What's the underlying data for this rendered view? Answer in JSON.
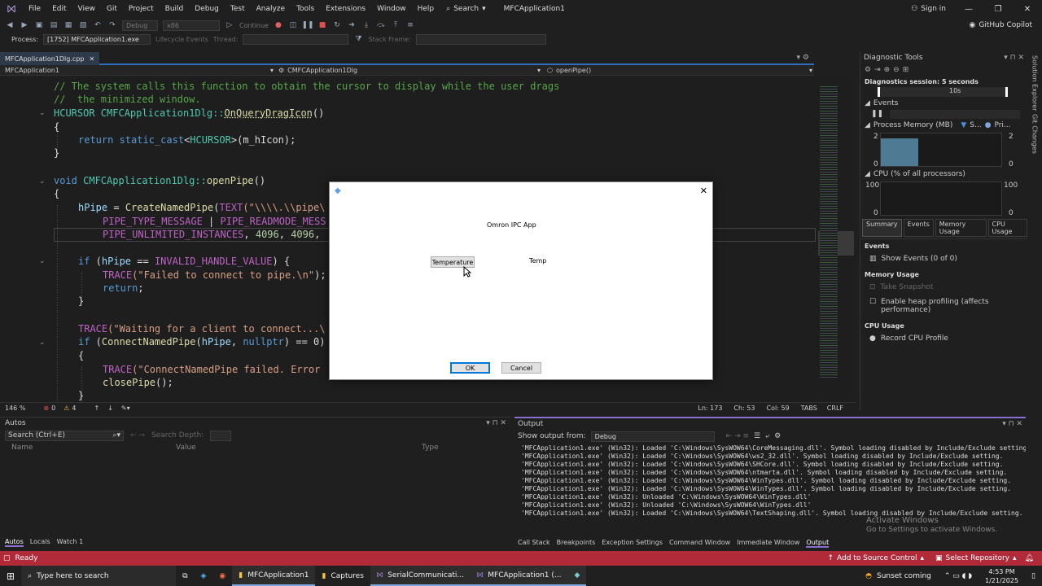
{
  "menubar": {
    "items": [
      "File",
      "Edit",
      "View",
      "Git",
      "Project",
      "Build",
      "Debug",
      "Test",
      "Analyze",
      "Tools",
      "Extensions",
      "Window",
      "Help"
    ],
    "search_label": "Search",
    "solution_name": "MFCApplication1",
    "signin_label": "Sign in",
    "minimize_glyph": "—",
    "maximize_glyph": "❐",
    "close_glyph": "✕"
  },
  "toolbar": {
    "config": "Debug",
    "platform": "x86",
    "continue_label": "Continue",
    "copilot_label": "GitHub Copilot"
  },
  "toolbar2": {
    "process_label": "Process:",
    "process_value": "[1752] MFCApplication1.exe",
    "lifecycle_label": "Lifecycle Events",
    "thread_label": "Thread:",
    "stackframe_label": "Stack Frame:"
  },
  "doc_tab": {
    "label": "MFCApplication1Dlg.cpp",
    "close": "✕"
  },
  "navbar": {
    "project": "MFCApplication1",
    "class": "CMFCApplication1Dlg",
    "member": "openPipe()"
  },
  "code": {
    "l1": "// The system calls this function to obtain the cursor to display while the user drags",
    "l2": "//  the minimized window.",
    "l3_type": "HCURSOR",
    "l3_class": " CMFCApplication1Dlg::",
    "l3_fn": "OnQueryDragIcon",
    "l3_rest": "()",
    "l4": "{",
    "l5_kw": "return",
    "l5_cast": " static_cast",
    "l5_t": "<",
    "l5_type": "HCURSOR",
    "l5_rest": ">(m_hIcon);",
    "l6": "}",
    "l8_kw": "void",
    "l8_class": " CMFCApplication1Dlg::",
    "l8_fn": "openPipe",
    "l8_rest": "()",
    "l9": "{",
    "l10_var": "hPipe",
    "l10_eq": " = ",
    "l10_fn": "CreateNamedPipe",
    "l10_p": "(",
    "l10_mac": "TEXT",
    "l10_str": "(\"\\\\\\\\.\\\\pipe\\",
    "l11_mac": "PIPE_TYPE_MESSAGE",
    "l11_op": " | ",
    "l11_mac2": "PIPE_READMODE_MESS",
    "l12_mac": "PIPE_UNLIMITED_INSTANCES",
    "l12_rest": ", ",
    "l12_num1": "4096",
    "l12_c": ", ",
    "l12_num2": "4096",
    "l12_end": ",",
    "l14_kw": "if",
    "l14_p": " (",
    "l14_var": "hPipe",
    "l14_op": " == ",
    "l14_mac": "INVALID_HANDLE_VALUE",
    "l14_end": ") {",
    "l15_mac": "TRACE",
    "l15_str": "(\"Failed to connect to pipe.\\n\"",
    "l15_end": ");",
    "l16_kw": "return",
    "l16_end": ";",
    "l17": "}",
    "l19_mac": "TRACE",
    "l19_str": "(\"Waiting for a client to connect...\\",
    "l20_kw": "if",
    "l20_p": " (",
    "l20_fn": "ConnectNamedPipe",
    "l20_a": "(",
    "l20_var": "hPipe",
    "l20_c": ", ",
    "l20_kw2": "nullptr",
    "l20_end": ") == 0)",
    "l21": "{",
    "l22_mac": "TRACE",
    "l22_str": "(\"ConnectNamedPipe failed. Error",
    "l23_fn": "closePipe",
    "l23_end": "();",
    "l24": "}"
  },
  "editor_status": {
    "zoom": "146 %",
    "errors": "0",
    "warnings": "4",
    "ln": "Ln: 173",
    "ch": "Ch: 53",
    "col": "Col: 59",
    "tabs": "TABS",
    "eol": "CRLF"
  },
  "diag": {
    "title": "Diagnostic Tools",
    "session": "Diagnostics session: 5 seconds",
    "time_tick": "10s",
    "events_label": "Events",
    "memory_label": "Process Memory (MB)",
    "memory_legend1": "S...",
    "memory_legend2": "Pri...",
    "mem_y_top": "2",
    "mem_y_bottom": "0",
    "cpu_label": "CPU (% of all processors)",
    "cpu_y_top": "100",
    "cpu_y_bottom": "0",
    "tabs": [
      "Summary",
      "Events",
      "Memory Usage",
      "CPU Usage"
    ],
    "sec_events": "Events",
    "show_events": "Show Events (0 of 0)",
    "sec_memory": "Memory Usage",
    "take_snapshot": "Take Snapshot",
    "heap_profiling": "Enable heap profiling (affects performance)",
    "sec_cpu": "CPU Usage",
    "record_cpu": "Record CPU Profile",
    "memory_fraction": 0.85
  },
  "side_tabs": [
    "Solution Explorer",
    "Git Changes"
  ],
  "autos": {
    "title": "Autos",
    "search_placeholder": "Search (Ctrl+E)",
    "search_depth": "Search Depth:",
    "col_name": "Name",
    "col_value": "Value",
    "col_type": "Type",
    "tabs": [
      "Autos",
      "Locals",
      "Watch 1"
    ]
  },
  "output": {
    "title": "Output",
    "show_from_label": "Show output from:",
    "show_from_value": "Debug",
    "lines": [
      "'MFCApplication1.exe' (Win32): Loaded 'C:\\Windows\\SysWOW64\\CoreMessaging.dll'. Symbol loading disabled by Include/Exclude setting.",
      "'MFCApplication1.exe' (Win32): Loaded 'C:\\Windows\\SysWOW64\\ws2_32.dll'. Symbol loading disabled by Include/Exclude setting.",
      "'MFCApplication1.exe' (Win32): Loaded 'C:\\Windows\\SysWOW64\\SHCore.dll'. Symbol loading disabled by Include/Exclude setting.",
      "'MFCApplication1.exe' (Win32): Loaded 'C:\\Windows\\SysWOW64\\ntmarta.dll'. Symbol loading disabled by Include/Exclude setting.",
      "'MFCApplication1.exe' (Win32): Loaded 'C:\\Windows\\SysWOW64\\WinTypes.dll'. Symbol loading disabled by Include/Exclude setting.",
      "'MFCApplication1.exe' (Win32): Loaded 'C:\\Windows\\SysWOW64\\WinTypes.dll'. Symbol loading disabled by Include/Exclude setting.",
      "'MFCApplication1.exe' (Win32): Unloaded 'C:\\Windows\\SysWOW64\\WinTypes.dll'",
      "'MFCApplication1.exe' (Win32): Unloaded 'C:\\Windows\\SysWOW64\\WinTypes.dll'",
      "'MFCApplication1.exe' (Win32): Loaded 'C:\\Windows\\SysWOW64\\TextShaping.dll'. Symbol loading disabled by Include/Exclude setting."
    ],
    "watermark1": "Activate Windows",
    "watermark2": "Go to Settings to activate Windows.",
    "tabs": [
      "Call Stack",
      "Breakpoints",
      "Exception Settings",
      "Command Window",
      "Immediate Window",
      "Output"
    ]
  },
  "statusbar": {
    "ready": "Ready",
    "add_source": "Add to Source Control",
    "select_repo": "Select Repository"
  },
  "dialog": {
    "app_text": "Omron IPC App",
    "temperature_button": "Temperature",
    "temp_label": "Temp",
    "ok": "OK",
    "cancel": "Cancel",
    "close": "✕"
  },
  "taskbar": {
    "search_placeholder": "Type here to search",
    "apps": [
      "MFCApplication1",
      "Captures",
      "SerialCommunicati...",
      "MFCApplication1 (..."
    ],
    "weather": "Sunset coming",
    "time": "4:53 PM",
    "date": "1/21/2025"
  },
  "colors": {
    "accent": "#8a6fd1",
    "status_bar": "#b02a3a",
    "editor_bg": "#1e1e1e"
  }
}
